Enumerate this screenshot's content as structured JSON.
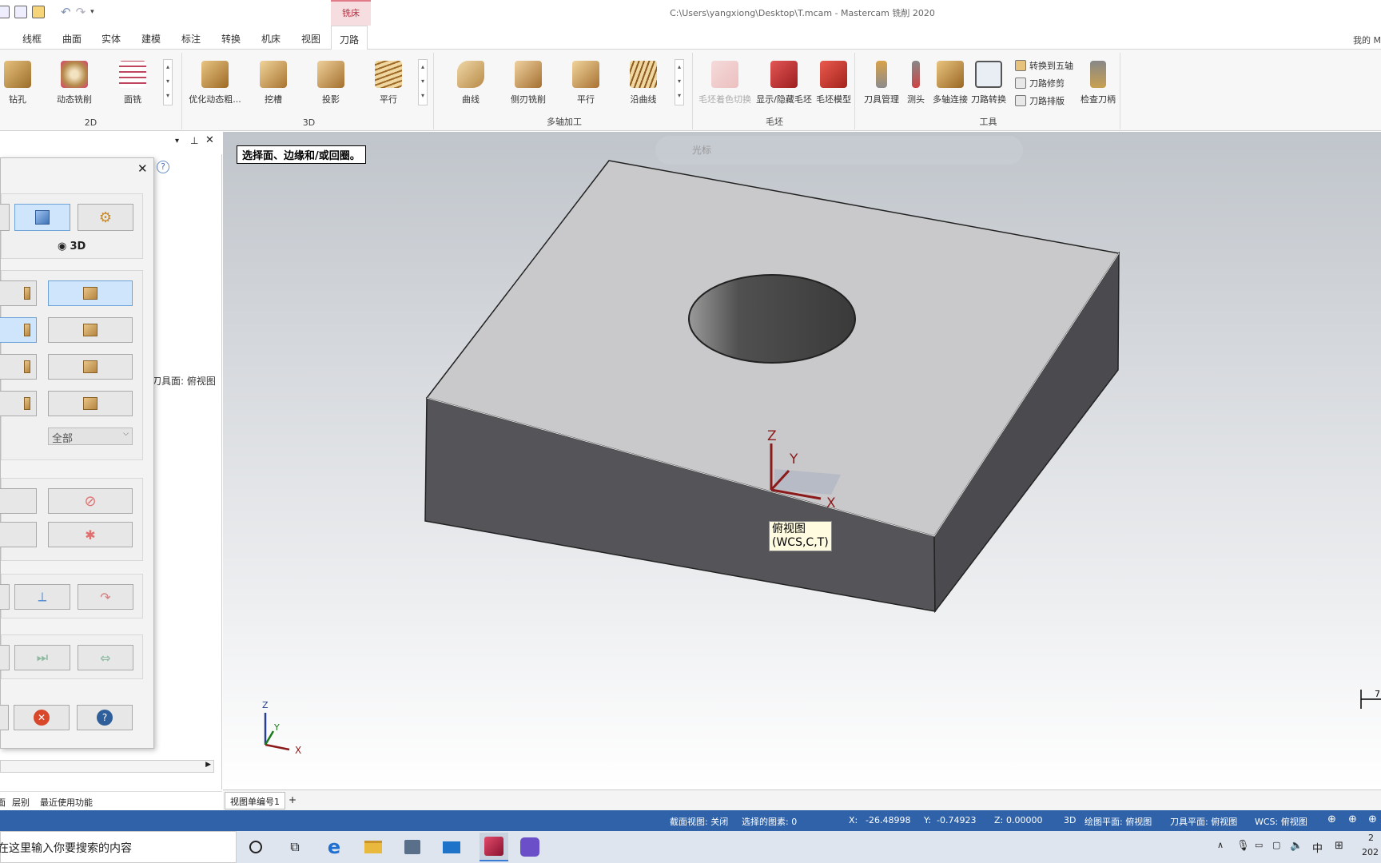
{
  "window": {
    "title": "C:\\Users\\yangxiong\\Desktop\\T.mcam - Mastercam 铣削 2020",
    "context_tab": "铣床",
    "my_label": "我的 M"
  },
  "ribbon_tabs": [
    "线框",
    "曲面",
    "实体",
    "建模",
    "标注",
    "转换",
    "机床",
    "视图",
    "刀路"
  ],
  "ribbon": {
    "group_2d": {
      "label": "2D",
      "buttons": [
        "钻孔",
        "动态铣削",
        "面铣"
      ]
    },
    "group_3d": {
      "label": "3D",
      "buttons": [
        "优化动态粗...",
        "挖槽",
        "投影",
        "平行"
      ]
    },
    "group_multi": {
      "label": "多轴加工",
      "buttons": [
        "曲线",
        "侧刃铣削",
        "平行",
        "沿曲线"
      ]
    },
    "group_stock": {
      "label": "毛坯",
      "buttons": [
        "毛坯着色切换",
        "显示/隐藏毛坯",
        "毛坯模型"
      ]
    },
    "group_tools": {
      "label": "工具",
      "buttons": [
        "刀具管理",
        "测头",
        "多轴连接",
        "刀路转换"
      ],
      "small": [
        "转换到五轴",
        "刀路修剪",
        "刀路排版"
      ],
      "last": "检查刀柄"
    }
  },
  "left_pane": {
    "partial_text": "刀具面: 俯视图",
    "dialog": {
      "radio_3d": "3D",
      "dropdown": "全部"
    },
    "bottom_tabs": [
      "面",
      "层别",
      "最近使用功能"
    ]
  },
  "viewport": {
    "prompt": "选择面、边缘和/或回圈。",
    "toolbar_label": "光标",
    "tooltip_line1": "俯视图",
    "tooltip_line2": "(WCS,C,T)",
    "axis": {
      "x": "X",
      "y": "Y",
      "z": "Z"
    },
    "scale_label": "7"
  },
  "sheet_tabs": {
    "current": "视图单编号1",
    "add": "+"
  },
  "status": {
    "section_view": "截面视图: 关闭",
    "selected": "选择的图素: 0",
    "x_label": "X:",
    "x_value": "-26.48998",
    "y_label": "Y:",
    "y_value": "-0.74923",
    "z_label": "Z:",
    "z_value": "0.00000",
    "mode": "3D",
    "cplane": "绘图平面: 俯视图",
    "tplane": "刀具平面: 俯视图",
    "wcs": "WCS: 俯视图"
  },
  "taskbar": {
    "search_placeholder": "在这里输入你要搜索的内容",
    "ime": "中",
    "clock_top": "2",
    "clock_bottom": "202"
  },
  "colors": {
    "accent": "#2f62a8",
    "context_tab": "#b0303f",
    "axis": "#8b1a1a"
  }
}
